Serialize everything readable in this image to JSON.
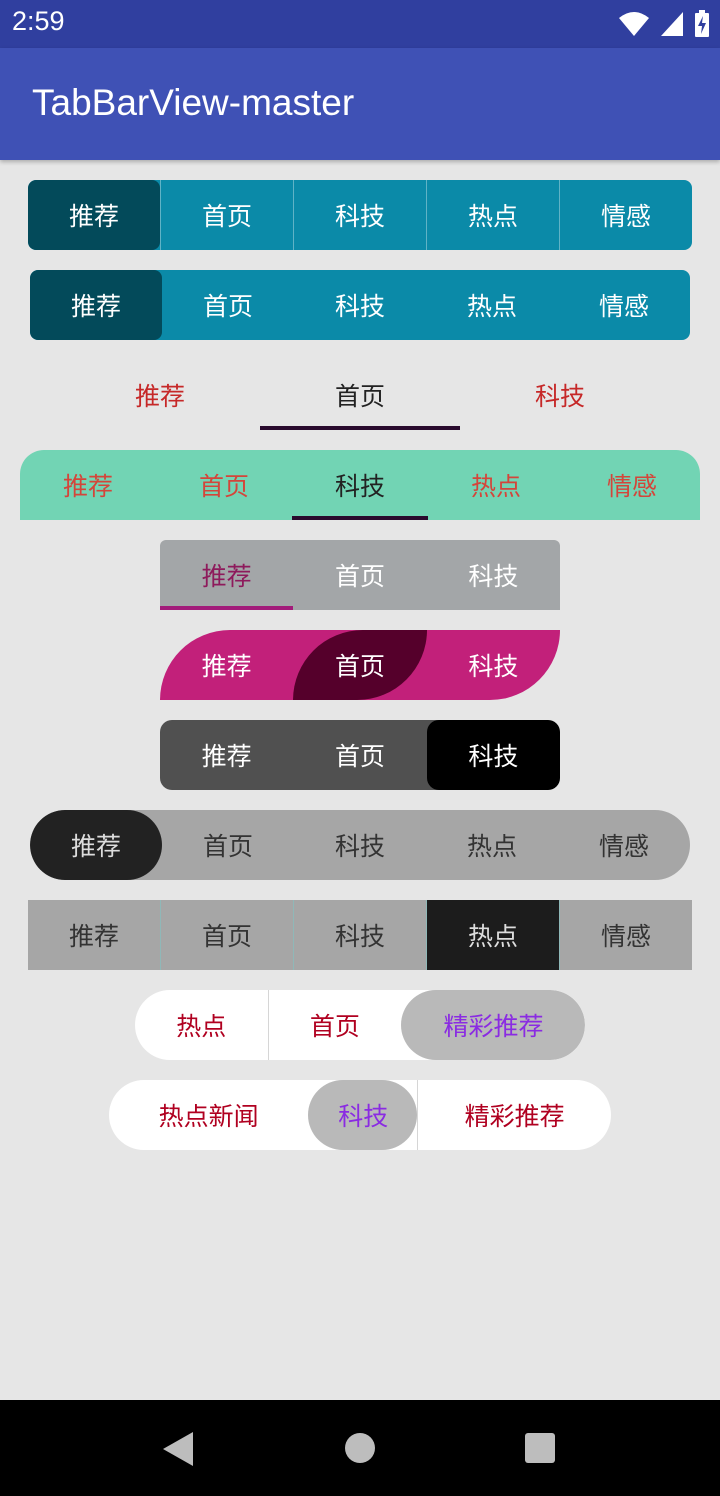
{
  "status_bar": {
    "time": "2:59",
    "icons": [
      "wifi-icon",
      "cell-signal-icon",
      "battery-charging-icon"
    ]
  },
  "app_bar": {
    "title": "TabBarView-master"
  },
  "tab_bars": [
    {
      "tabs": [
        "推荐",
        "首页",
        "科技",
        "热点",
        "情感"
      ],
      "selected": 0
    },
    {
      "tabs": [
        "推荐",
        "首页",
        "科技",
        "热点",
        "情感"
      ],
      "selected": 0
    },
    {
      "tabs": [
        "推荐",
        "首页",
        "科技"
      ],
      "selected": 1
    },
    {
      "tabs": [
        "推荐",
        "首页",
        "科技",
        "热点",
        "情感"
      ],
      "selected": 2
    },
    {
      "tabs": [
        "推荐",
        "首页",
        "科技"
      ],
      "selected": 0
    },
    {
      "tabs": [
        "推荐",
        "首页",
        "科技"
      ],
      "selected": 1
    },
    {
      "tabs": [
        "推荐",
        "首页",
        "科技"
      ],
      "selected": 2
    },
    {
      "tabs": [
        "推荐",
        "首页",
        "科技",
        "热点",
        "情感"
      ],
      "selected": 0
    },
    {
      "tabs": [
        "推荐",
        "首页",
        "科技",
        "热点",
        "情感"
      ],
      "selected": 3
    },
    {
      "tabs": [
        "热点",
        "首页",
        "精彩推荐"
      ],
      "selected": 2
    },
    {
      "tabs": [
        "热点新闻",
        "科技",
        "精彩推荐"
      ],
      "selected": 1
    }
  ],
  "colors": {
    "status_bar": "#303f9f",
    "app_bar": "#3f51b5",
    "teal": "#0b8aa8",
    "teal_selected": "#034a5a",
    "mint": "#72d4b4",
    "magenta": "#c2207a",
    "magenta_selected": "#55002b",
    "red_text": "#b00020",
    "purple_text": "#8a2be2"
  },
  "nav_bar": {
    "icons": [
      "back-icon",
      "home-icon",
      "recents-icon"
    ]
  }
}
